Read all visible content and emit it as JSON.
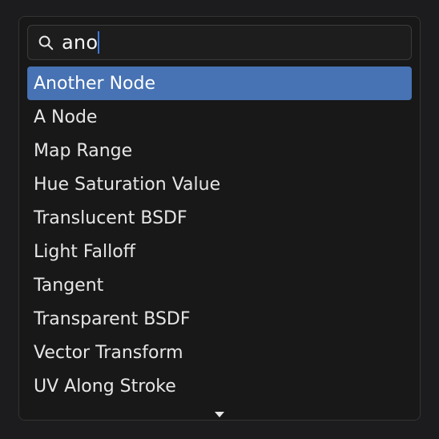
{
  "search": {
    "query": "ano",
    "placeholder": ""
  },
  "results": [
    {
      "label": "Another Node",
      "selected": true
    },
    {
      "label": "A Node",
      "selected": false
    },
    {
      "label": "Map Range",
      "selected": false
    },
    {
      "label": "Hue Saturation Value",
      "selected": false
    },
    {
      "label": "Translucent BSDF",
      "selected": false
    },
    {
      "label": "Light Falloff",
      "selected": false
    },
    {
      "label": "Tangent",
      "selected": false
    },
    {
      "label": "Transparent BSDF",
      "selected": false
    },
    {
      "label": "Vector Transform",
      "selected": false
    },
    {
      "label": "UV Along Stroke",
      "selected": false
    }
  ],
  "icons": {
    "search": "search-icon",
    "more": "chevron-down-icon"
  },
  "colors": {
    "selection": "#4772b3",
    "caret": "#3f7ae0",
    "panel_bg": "#181818",
    "panel_border": "#333333",
    "input_bg": "#1d1d1d",
    "input_border": "#3b3b3b"
  }
}
